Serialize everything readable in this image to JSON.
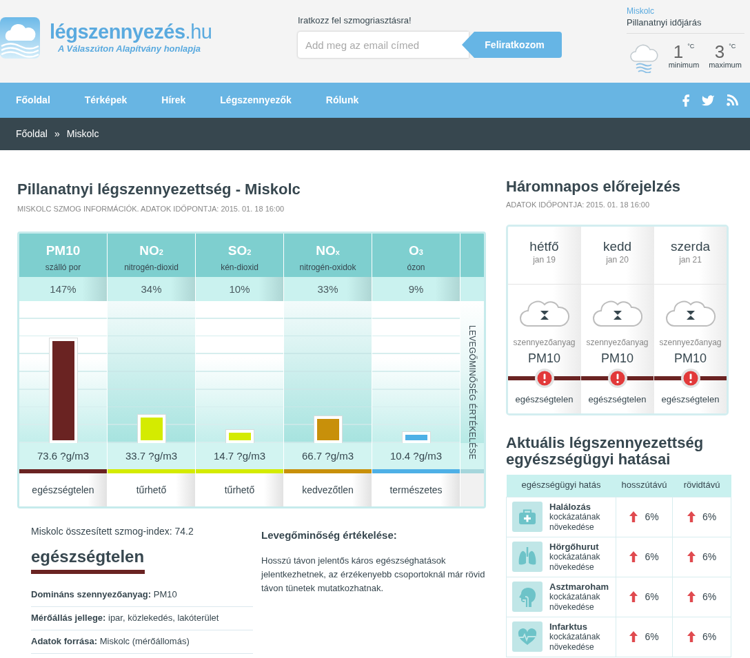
{
  "header": {
    "logo": {
      "title": "**légszennyezés**.hu",
      "tagline": "A Válaszúton Alapítvány honlapja"
    },
    "subscribe": {
      "label": "Iratkozz fel szmogriasztásra!",
      "placeholder": "Add meg az email címed",
      "button": "Feliratkozom"
    },
    "weather": {
      "city": "Miskolc",
      "title": "Pillanatnyi időjárás",
      "readings": [
        {
          "value": "1",
          "unit": "°C",
          "label": "minimum"
        },
        {
          "value": "3",
          "unit": "°C",
          "label": "maximum"
        }
      ]
    }
  },
  "nav": {
    "items": [
      "Főoldal",
      "Térképek",
      "Hírek",
      "Légszennyezők",
      "Rólunk"
    ]
  },
  "breadcrumb": {
    "items": [
      "Főoldal",
      "Miskolc"
    ],
    "separator": "»"
  },
  "current": {
    "title": "Pillanatnyi légszennyezettség - Miskolc",
    "subtitle": "MISKOLC SZMOG INFORMÁCIÓK. ADATOK IDŐPONTJA: 2015. 01. 18 16:00",
    "pollutants": [
      {
        "symbol": "PM10",
        "name": "szálló por",
        "percent": "147%",
        "level": 0.74,
        "value": "73.6 ?g/m3",
        "color": "#6a2322",
        "rating": "egészségtelen"
      },
      {
        "symbol": "NO$_{2}$",
        "name": "nitrogén-dioxid",
        "percent": "34%",
        "level": 0.2,
        "value": "33.7 ?g/m3",
        "color": "#d4eb00",
        "rating": "tűrhető"
      },
      {
        "symbol": "SO$_{2}$",
        "name": "kén-dioxid",
        "percent": "10%",
        "level": 0.09,
        "value": "14.7 ?g/m3",
        "color": "#d4eb00",
        "rating": "tűrhető"
      },
      {
        "symbol": "NO$_{x}$",
        "name": "nitrogén-oxidok",
        "percent": "33%",
        "level": 0.19,
        "value": "66.7 ?g/m3",
        "color": "#c8900a",
        "rating": "kedvezőtlen"
      },
      {
        "symbol": "O$_{3}$",
        "name": "ózon",
        "percent": "9%",
        "level": 0.08,
        "value": "10.4 ?g/m3",
        "color": "#4eb0e6",
        "rating": "természetes"
      }
    ],
    "side_label": "LEVEGŐMINŐSÉG ÉRTÉKELÉSE",
    "summary": {
      "index": "Miskolc összesített szmog-index: 74.2",
      "rating": "egészségtelen",
      "facts": [
        "**Domináns szennyezőanyag:** PM10",
        "**Mérőállás jellege:** ipar, közlekedés, lakóterület",
        "**Adatok forrása:** Miskolc (mérőállomás)"
      ]
    },
    "assessment": {
      "title": "Levegőminőség értékelése:",
      "text": "Hosszú távon jelentős káros egészséghatások jelentkezhetnek, az érzékenyebb csoportoknál már rövid távon tünetek mutatkozhatnak."
    }
  },
  "forecast": {
    "title": "Háromnapos előrejelzés",
    "subtitle": "ADATOK IDŐPONTJA: 2015. 01. 18 16:00",
    "days": [
      {
        "day": "hétfő",
        "date": "jan 19",
        "label": "szennyezőanyag",
        "pollutant": "PM10",
        "rating": "egészségtelen"
      },
      {
        "day": "kedd",
        "date": "jan 20",
        "label": "szennyezőanyag",
        "pollutant": "PM10",
        "rating": "egészségtelen"
      },
      {
        "day": "szerda",
        "date": "jan 21",
        "label": "szennyezőanyag",
        "pollutant": "PM10",
        "rating": "egészségtelen"
      }
    ]
  },
  "health": {
    "title": "Aktuális légszennyezettség egyészségügyi hatásai",
    "columns": [
      "egészségügyi hatás",
      "hosszútávú",
      "rövidtávú"
    ],
    "rows": [
      {
        "name": "Halálozás",
        "description": "kockázatának növekedése",
        "long_term": "6%",
        "short_term": "6%"
      },
      {
        "name": "Hörgőhurut",
        "description": "kockázatának növekedése",
        "long_term": "6%",
        "short_term": "6%"
      },
      {
        "name": "Asztmaroham",
        "description": "kockázatának növekedése",
        "long_term": "6%",
        "short_term": "6%"
      },
      {
        "name": "Infarktus",
        "description": "kockázatának növekedése",
        "long_term": "6%",
        "short_term": "6%"
      }
    ]
  }
}
